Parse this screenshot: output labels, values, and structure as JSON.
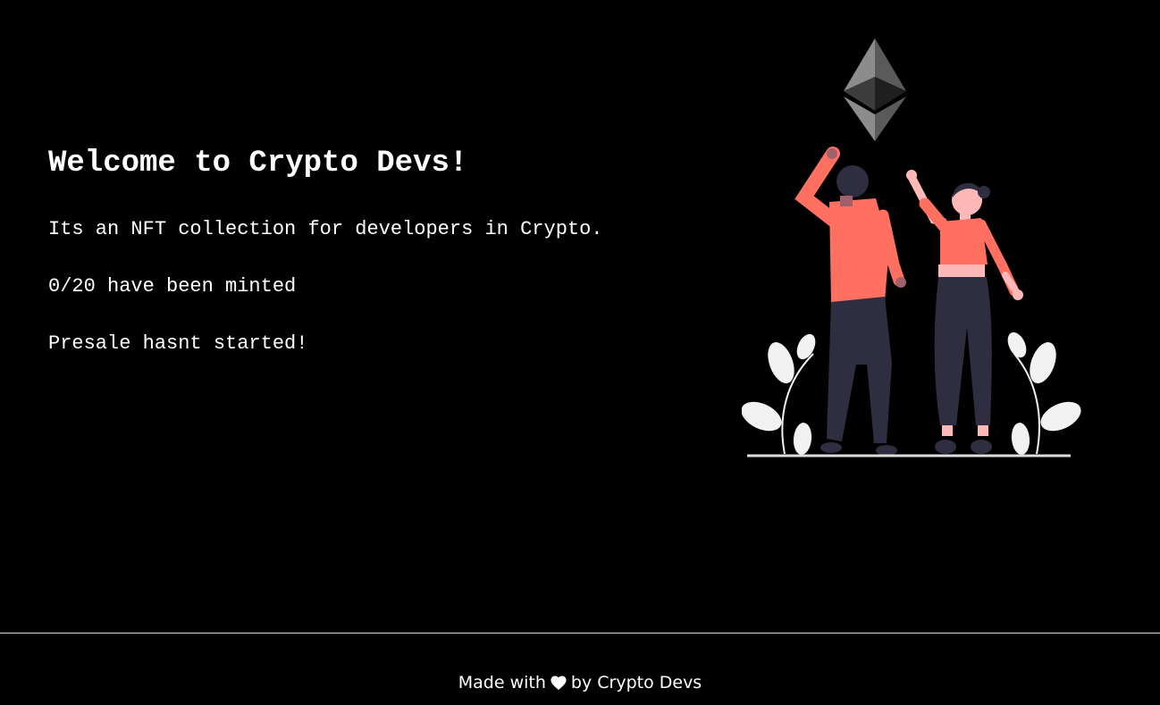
{
  "intro": {
    "title": "Welcome to Crypto Devs!",
    "description": "Its an NFT collection for developers in Crypto.",
    "minted": "0/20 have been minted",
    "presale_status": "Presale hasnt started!"
  },
  "illustration": {
    "icon": "ethereum-icon",
    "subject": "two-people-reaching-up",
    "colors": {
      "shirt": "#ff7061",
      "pants": "#2f2e41",
      "skin_man": "#a0616a",
      "skin_woman": "#ffb8b8",
      "leaves": "#f2f2f2"
    }
  },
  "footer": {
    "prefix": "Made with",
    "icon": "heart-icon",
    "suffix": "by Crypto Devs"
  }
}
